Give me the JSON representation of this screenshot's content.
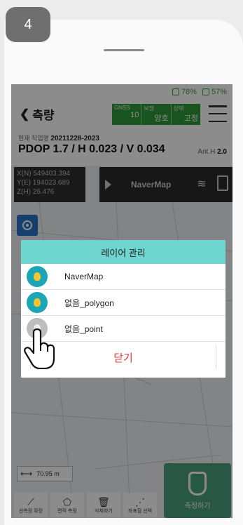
{
  "step_number": "4",
  "status": {
    "signal": "78%",
    "battery": "57%"
  },
  "header": {
    "back_label": "측량",
    "gnss": [
      {
        "key": "GNSS",
        "value": "10"
      },
      {
        "key": "보정",
        "value": "양호"
      },
      {
        "key": "상태",
        "value": "고정"
      }
    ]
  },
  "info": {
    "work_prefix": "현재 작업명",
    "work_name": "20211228-2023",
    "pdop": "PDOP 1.7 / H 0.023 / V 0.034",
    "ant_label": "Ant.H",
    "ant_value": "2.0"
  },
  "coords": {
    "x": "X(N) 549403.394",
    "y": "Y(E) 194023.689",
    "z": "Z(H) 26.476"
  },
  "layer_bar": {
    "name": "NaverMap"
  },
  "dialog": {
    "title": "레이어 관리",
    "layers": [
      {
        "label": "NaverMap",
        "active": true
      },
      {
        "label": "없음_polygon",
        "active": true
      },
      {
        "label": "없음_point",
        "active": false
      }
    ],
    "close_label": "닫기"
  },
  "scale": "70.95 m",
  "tools": [
    "선측정 확장",
    "면적 측정",
    "삭제하기",
    "좌표점 선택"
  ],
  "survey_label": "측정하기",
  "colors": {
    "accent": "#6fd6cf",
    "gnss": "#2e9a3a",
    "close": "#e53935",
    "bulb_on": "#1aa6b7"
  }
}
